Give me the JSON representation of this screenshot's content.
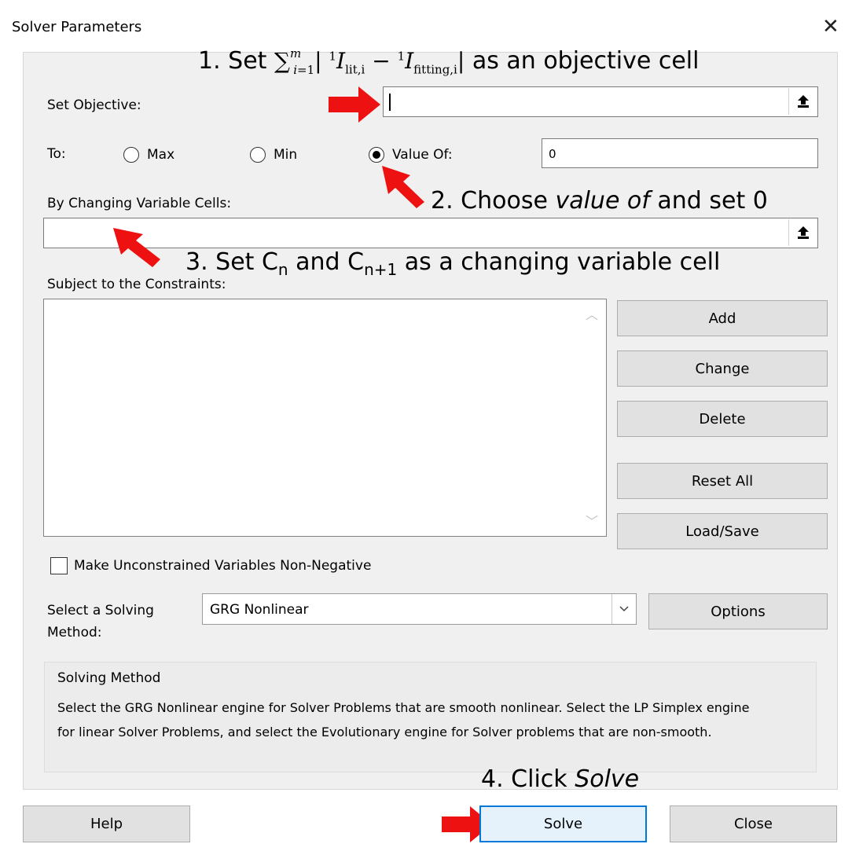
{
  "window": {
    "title": "Solver Parameters",
    "close_glyph": "✕"
  },
  "objective": {
    "label": "Set Objective:",
    "value": ""
  },
  "to": {
    "label": "To:",
    "options": [
      "Max",
      "Min",
      "Value Of:"
    ],
    "selected": "Value Of:",
    "value_of": "0"
  },
  "changing_cells": {
    "label": "By Changing Variable Cells:",
    "value": ""
  },
  "constraints": {
    "label": "Subject to the Constraints:",
    "items": []
  },
  "side_buttons": [
    "Add",
    "Change",
    "Delete",
    "Reset All",
    "Load/Save"
  ],
  "nonneg": {
    "label": "Make Unconstrained Variables Non-Negative",
    "checked": false
  },
  "method": {
    "label_line1": "Select a Solving",
    "label_line2": "Method:",
    "selected": "GRG Nonlinear",
    "options_button": "Options"
  },
  "solving_method": {
    "heading": "Solving Method",
    "description": "Select the GRG Nonlinear engine for Solver Problems that are smooth nonlinear. Select the LP Simplex engine for linear Solver Problems, and select the Evolutionary engine for Solver problems that are non-smooth."
  },
  "footer": {
    "help": "Help",
    "solve": "Solve",
    "close": "Close"
  },
  "annotations": {
    "step1_prefix": "1. Set ",
    "step1_suffix": " as an objective cell",
    "step2_prefix": "2. Choose ",
    "step2_italic": "value of",
    "step2_suffix": " and set 0",
    "step3_prefix": "3. Set C",
    "step3_sub1": "n",
    "step3_mid": " and C",
    "step3_sub2": "n+1",
    "step3_suffix": " as a changing variable cell",
    "step4_prefix": "4. Click ",
    "step4_italic": "Solve"
  },
  "colors": {
    "arrow": "#ee1111",
    "focus": "#0078d7",
    "panel": "#f0f0f0"
  }
}
